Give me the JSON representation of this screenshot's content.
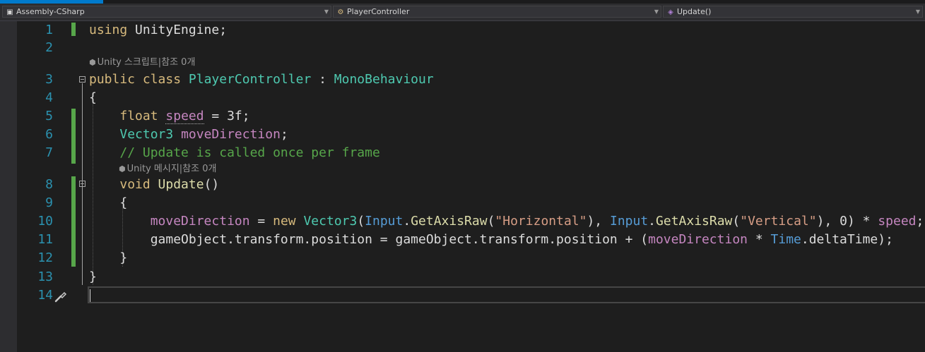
{
  "colors": {
    "accent": "#007acc",
    "editor_bg": "#1e1e1e",
    "line_number": "#2b91af",
    "change_bar": "#57a64a"
  },
  "navbar": {
    "project": {
      "icon": "csharp-project-icon",
      "label": "Assembly-CSharp"
    },
    "class": {
      "icon": "class-icon",
      "label": "PlayerController"
    },
    "member": {
      "icon": "method-icon",
      "label": "Update()"
    }
  },
  "lens": {
    "class_lens": "Unity 스크립트|참조 0개",
    "method_lens": "Unity 메시지|참조 0개"
  },
  "lines": [
    {
      "number": "1",
      "tokens": [
        [
          "kw",
          "using"
        ],
        [
          "plain",
          " UnityEngine;"
        ]
      ]
    },
    {
      "number": "2",
      "tokens": []
    },
    {
      "number": "3",
      "tokens": [
        [
          "kw",
          "public class "
        ],
        [
          "class",
          "PlayerController"
        ],
        [
          "plain",
          " : "
        ],
        [
          "type",
          "MonoBehaviour"
        ]
      ]
    },
    {
      "number": "4",
      "tokens": [
        [
          "plain",
          "{"
        ]
      ]
    },
    {
      "number": "5",
      "tokens": [
        [
          "plain",
          "    "
        ],
        [
          "kw",
          "float "
        ],
        [
          "field",
          "speed"
        ],
        [
          "plain",
          " = 3f;"
        ]
      ]
    },
    {
      "number": "6",
      "tokens": [
        [
          "plain",
          "    "
        ],
        [
          "type",
          "Vector3 "
        ],
        [
          "field",
          "moveDirection"
        ],
        [
          "plain",
          ";"
        ]
      ]
    },
    {
      "number": "7",
      "tokens": [
        [
          "plain",
          "    "
        ],
        [
          "comment",
          "// Update is called once per frame"
        ]
      ]
    },
    {
      "number": "8",
      "tokens": [
        [
          "plain",
          "    "
        ],
        [
          "kw",
          "void "
        ],
        [
          "method",
          "Update"
        ],
        [
          "plain",
          "()"
        ]
      ]
    },
    {
      "number": "9",
      "tokens": [
        [
          "plain",
          "    {"
        ]
      ]
    },
    {
      "number": "10",
      "tokens": [
        [
          "plain",
          "        "
        ],
        [
          "field",
          "moveDirection"
        ],
        [
          "plain",
          " = "
        ],
        [
          "kw",
          "new "
        ],
        [
          "type",
          "Vector3"
        ],
        [
          "plain",
          "("
        ],
        [
          "blue",
          "Input"
        ],
        [
          "plain",
          "."
        ],
        [
          "method",
          "GetAxisRaw"
        ],
        [
          "plain",
          "("
        ],
        [
          "str",
          "\"Horizontal\""
        ],
        [
          "plain",
          "), "
        ],
        [
          "blue",
          "Input"
        ],
        [
          "plain",
          "."
        ],
        [
          "method",
          "GetAxisRaw"
        ],
        [
          "plain",
          "("
        ],
        [
          "str",
          "\"Vertical\""
        ],
        [
          "plain",
          "), 0) * "
        ],
        [
          "field",
          "speed"
        ],
        [
          "plain",
          ";"
        ]
      ]
    },
    {
      "number": "11",
      "tokens": [
        [
          "plain",
          "        gameObject.transform.position = gameObject.transform.position + ("
        ],
        [
          "field",
          "moveDirection"
        ],
        [
          "plain",
          " * "
        ],
        [
          "blue",
          "Time"
        ],
        [
          "plain",
          ".deltaTime);"
        ]
      ]
    },
    {
      "number": "12",
      "tokens": [
        [
          "plain",
          "    }"
        ]
      ]
    },
    {
      "number": "13",
      "tokens": [
        [
          "plain",
          "}"
        ]
      ]
    },
    {
      "number": "14",
      "tokens": []
    }
  ]
}
